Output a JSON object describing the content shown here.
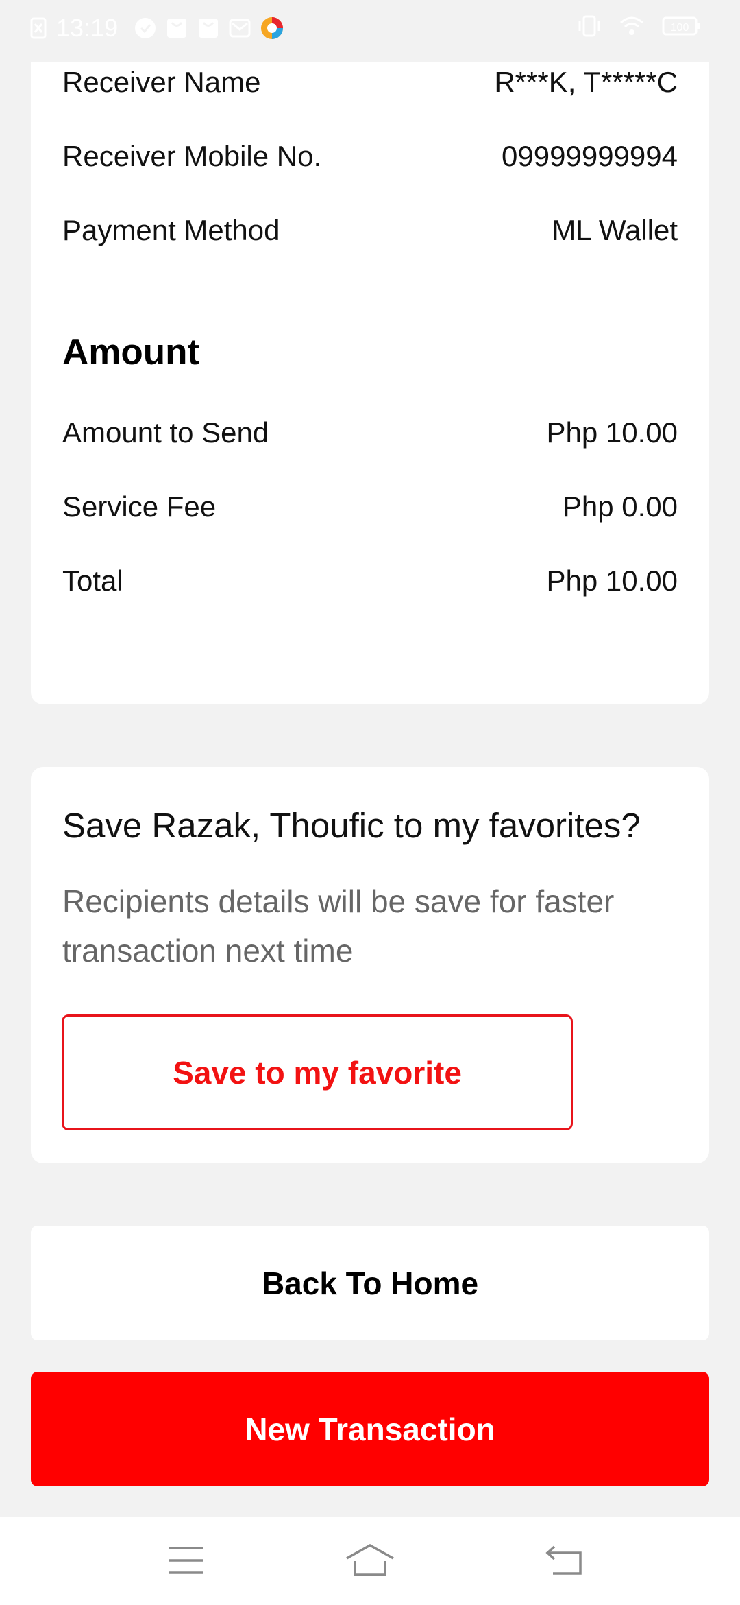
{
  "status_bar": {
    "time": "13:19",
    "battery": "100",
    "icons": [
      "sim-icon",
      "check-circle-icon",
      "bag-icon",
      "bag-icon",
      "mail-icon",
      "app-logo-icon",
      "vibrate-icon",
      "wifi-icon",
      "battery-icon"
    ]
  },
  "details": {
    "receiver_name_label": "Receiver Name",
    "receiver_name_value": "R***K, T*****C",
    "receiver_mobile_label": "Receiver Mobile No.",
    "receiver_mobile_value": "09999999994",
    "payment_method_label": "Payment Method",
    "payment_method_value": "ML Wallet"
  },
  "amount": {
    "title": "Amount",
    "amount_to_send_label": "Amount to Send",
    "amount_to_send_value": "Php 10.00",
    "service_fee_label": "Service Fee",
    "service_fee_value": "Php 0.00",
    "total_label": "Total",
    "total_value": "Php 10.00"
  },
  "favorite": {
    "title": "Save Razak, Thoufic to my favorites?",
    "description": "Recipients details will be save for faster transaction next time",
    "button_label": "Save to my favorite"
  },
  "actions": {
    "back_home_label": "Back To Home",
    "new_transaction_label": "New Transaction"
  },
  "colors": {
    "accent": "#ff0000",
    "background": "#f2f2f2",
    "card": "#ffffff"
  }
}
